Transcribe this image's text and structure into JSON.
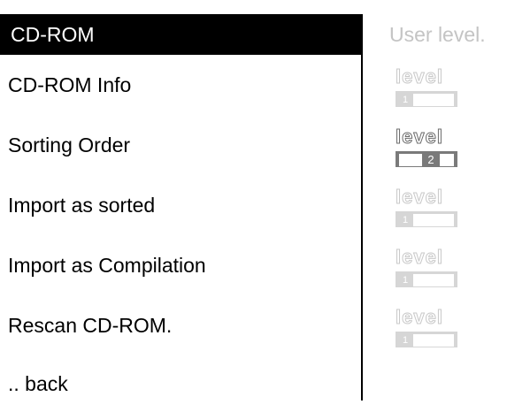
{
  "menu": {
    "header": "CD-ROM",
    "items": [
      {
        "label": "CD-ROM Info",
        "level": "1"
      },
      {
        "label": "Sorting Order",
        "level": "2"
      },
      {
        "label": "Import as sorted",
        "level": "1"
      },
      {
        "label": "Import as Compilation",
        "level": "1"
      },
      {
        "label": "Rescan CD-ROM.",
        "level": "1"
      }
    ],
    "back": ".. back"
  },
  "user_level": {
    "title": "User level.",
    "badge_label": "level",
    "current": "2"
  },
  "colors": {
    "header_bg": "#000000",
    "header_text": "#ffffff",
    "badge_inactive": "#d6d6d6",
    "badge_active": "#7a7a7a"
  }
}
